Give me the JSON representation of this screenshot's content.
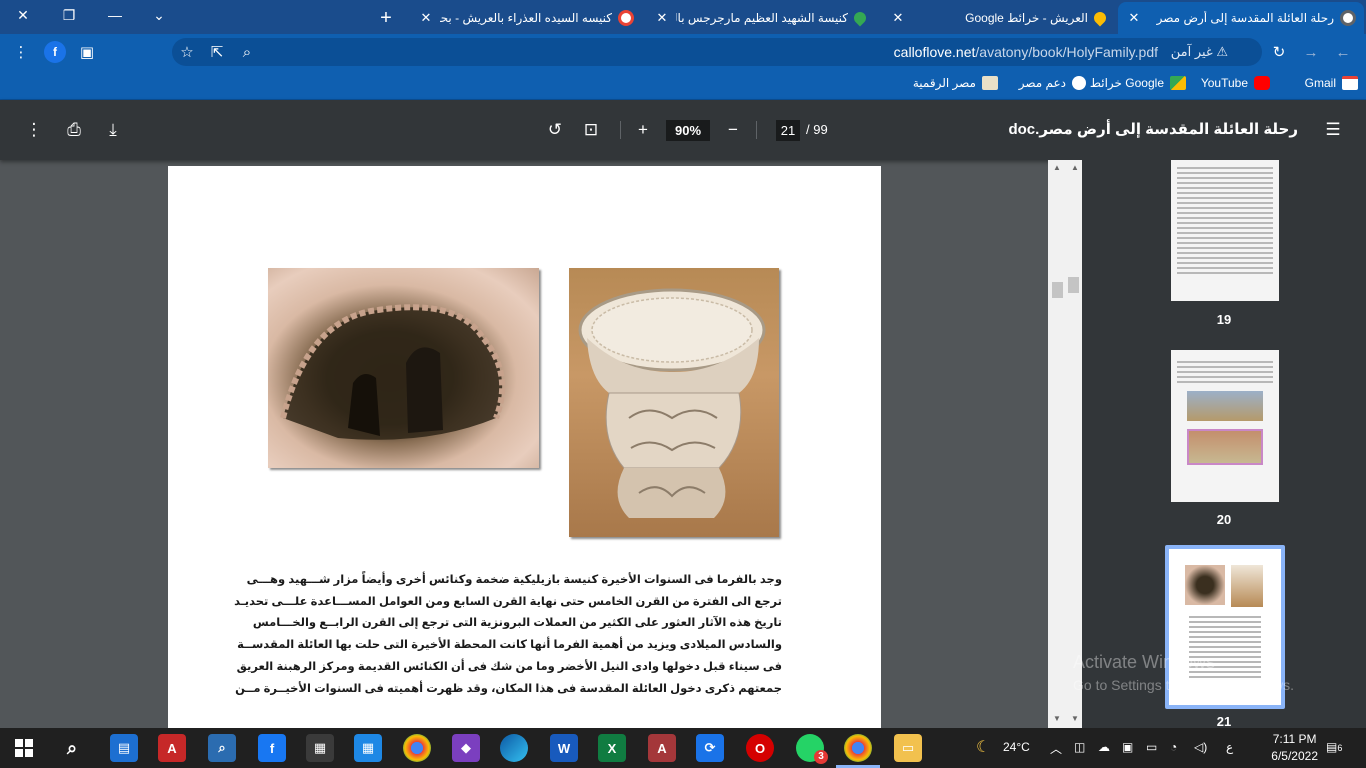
{
  "browser": {
    "tabs": [
      {
        "title": "رحلة العائلة المقدسة إلى أرض مصر",
        "active": true,
        "icon": "globe-icon"
      },
      {
        "title": "العريش - خرائط Google",
        "active": false,
        "icon": "maps-pin-icon"
      },
      {
        "title": "كنيسة الشهيد العظيم مارجرجس بالع",
        "active": false,
        "icon": "maps-pin-icon"
      },
      {
        "title": "كنيسه السيده العذراء بالعريش - بحث",
        "active": false,
        "icon": "google-icon"
      }
    ],
    "new_tab_symbol": "+",
    "close_symbol": "✕",
    "window": {
      "minimize": "—",
      "restore": "❐",
      "close": "✕",
      "tab_list": "⌄"
    },
    "address": {
      "security_label": "غير آمن",
      "url_host": "calloflove.net",
      "url_path": "/avatony/book/HolyFamily.pdf"
    },
    "profile_initial": "f",
    "bookmarks": [
      {
        "label": "Gmail",
        "icon": "gmail-icon",
        "color": "#ea4335"
      },
      {
        "label": "YouTube",
        "icon": "youtube-icon",
        "color": "#ff0000"
      },
      {
        "label": "خرائط Google",
        "icon": "maps-icon",
        "color": "#34a853"
      },
      {
        "label": "دعم مصر",
        "icon": "globe-icon",
        "color": "#ffffff"
      },
      {
        "label": "مصر الرقمية",
        "icon": "site-icon",
        "color": "#e8e0c8"
      }
    ]
  },
  "pdf": {
    "title": "رحلة العائلة المقدسة إلى أرض مصر.doc",
    "current_page": "21",
    "total_pages": "/ 99",
    "zoom": "90%",
    "body_lines": [
      "وجد بالفرما فى السنوات الأخيرة كنيسة بازيليكية ضخمة وكنائس أخرى وأيضاً مزار شـــهيد وهـــى",
      "ترجع الى الفترة من القرن الخامس حتى نهاية القرن السابع ومن العوامل المســـاعدة علـــى تحديـد",
      "تاريخ هذه الآثار العثور على الكثير من العملات البرونزية التى ترجع إلى القرن الرابــع والخـــامس",
      "والسادس الميلادى ويزيد من أهمية الفرما أنها كانت المحطة الأخيرة التى حلت بها العائلة المقدســة",
      "فى سيناء قبل دخولها وادى النيل الأخضر وما من شك فى أن الكنائس القديمة ومركز الرهبنة العريق",
      "جمعتهم ذكرى دخول العائلة المقدسة فى هذا المكان، وقد ظهرت أهميته فى السنوات الأخيــرة مــن"
    ],
    "thumbnails": [
      {
        "number": "19"
      },
      {
        "number": "20"
      },
      {
        "number": "21"
      }
    ]
  },
  "watermark": {
    "line1": "Activate Windows",
    "line2": "Go to Settings to activate Windows."
  },
  "taskbar": {
    "weather": "24°C",
    "language": "ع",
    "time": "7:11 PM",
    "date": "6/5/2022",
    "notifications": "6",
    "whatsapp_badge": "3"
  }
}
